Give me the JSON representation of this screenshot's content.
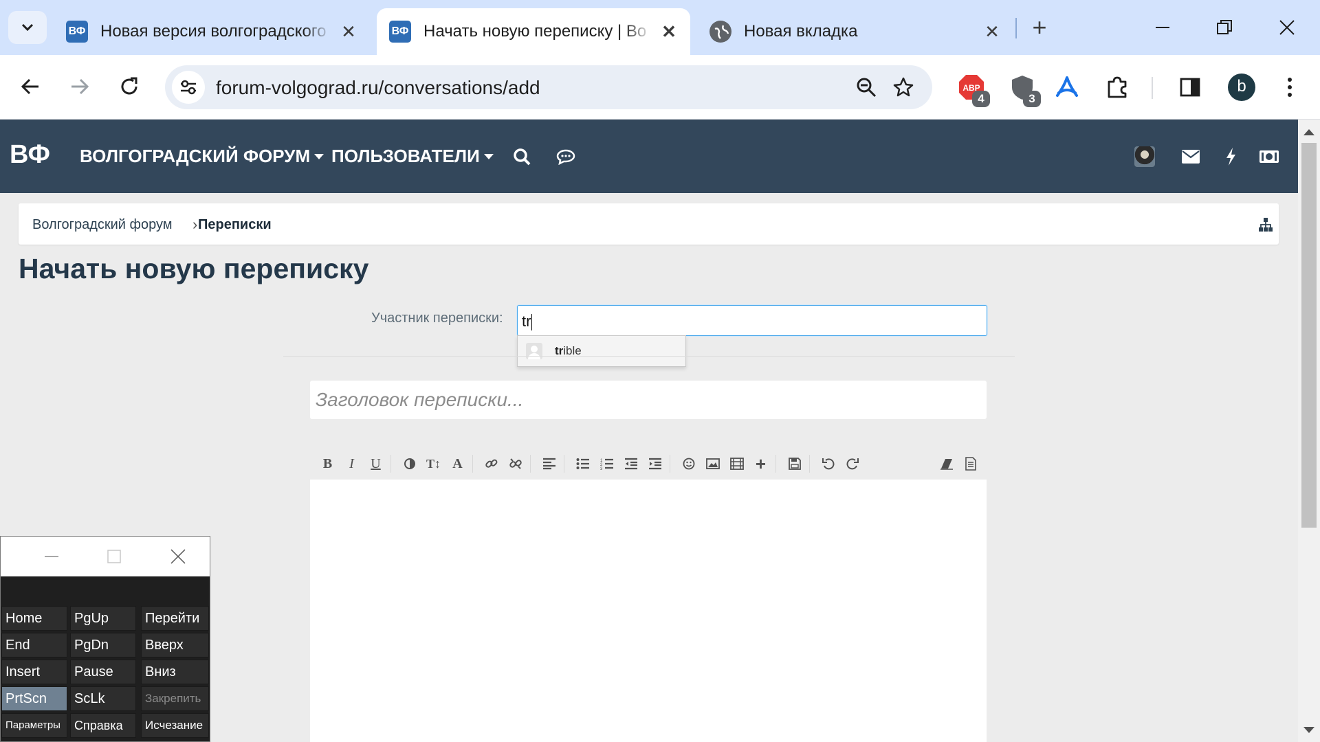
{
  "browser": {
    "tabs": [
      {
        "favicon": "ВФ",
        "title": "Новая версия волгоградского",
        "active": false
      },
      {
        "favicon": "ВФ",
        "title": "Начать новую переписку | Во",
        "active": true
      },
      {
        "favicon": "globe-icon",
        "title": "Новая вкладка",
        "active": false
      }
    ],
    "url": "forum-volgograd.ru/conversations/add",
    "extensions": {
      "adblock_badge": "4",
      "shield_badge": "3"
    },
    "profile_initial": "b"
  },
  "forum": {
    "logo": "ВФ",
    "nav": {
      "forum": "ВОЛГОГРАДСКИЙ ФОРУМ",
      "users": "ПОЛЬЗОВАТЕЛИ"
    },
    "breadcrumb": {
      "home": "Волгоградский форум",
      "separator": "›",
      "current": "Переписки"
    },
    "page_title": "Начать новую переписку",
    "form": {
      "recipient_label": "Участник переписки:",
      "recipient_value": "tr",
      "suggestion": {
        "match": "tr",
        "rest": "ible"
      },
      "title_placeholder": "Заголовок переписки..."
    }
  },
  "osk": {
    "rows": [
      [
        "Home",
        "PgUp",
        "Перейти"
      ],
      [
        "End",
        "PgDn",
        "Вверх"
      ],
      [
        "Insert",
        "Pause",
        "Вниз"
      ],
      [
        "PrtScn",
        "ScLk",
        "Закрепить"
      ],
      [
        "Параметры",
        "Справка",
        "Исчезание"
      ]
    ]
  },
  "colors": {
    "forum_header": "#33475b",
    "chrome_tabbar": "#d3e3fd",
    "focus_border": "#47a7eb"
  }
}
